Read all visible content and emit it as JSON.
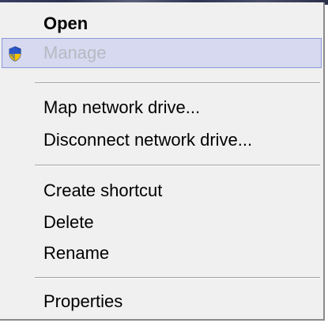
{
  "context_menu": {
    "items": [
      {
        "label": "Open"
      },
      {
        "label": "Manage",
        "icon": "uac-shield-icon"
      },
      {
        "label": "Map network drive..."
      },
      {
        "label": "Disconnect network drive..."
      },
      {
        "label": "Create shortcut"
      },
      {
        "label": "Delete"
      },
      {
        "label": "Rename"
      },
      {
        "label": "Properties"
      }
    ],
    "colors": {
      "menu_background": "#f0f0f0",
      "highlight_background": "#d6d9f0",
      "highlight_border": "#8f98d8",
      "disabled_text": "#b8b9c2"
    }
  }
}
